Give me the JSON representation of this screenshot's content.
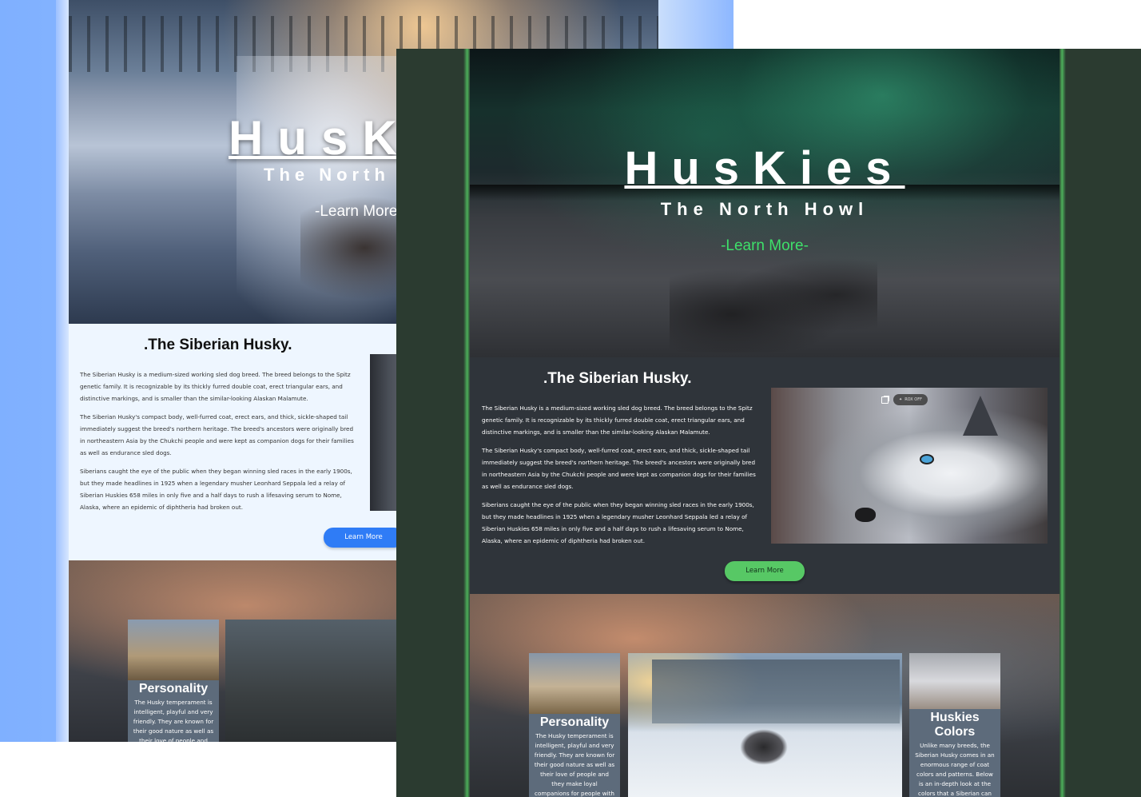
{
  "back_window": {
    "hero": {
      "title": "HusKies",
      "subtitle": "The North Howl",
      "learn_more": "-Learn More-"
    },
    "about": {
      "heading": ".The Siberian Husky.",
      "paragraphs": [
        "The Siberian Husky is a medium-sized working sled dog breed. The breed belongs to the Spitz genetic family. It is recognizable by its thickly furred double coat, erect triangular ears, and distinctive markings, and is smaller than the similar-looking Alaskan Malamute.",
        "The Siberian Husky's compact body, well-furred coat, erect ears, and thick, sickle-shaped tail immediately suggest the breed's northern heritage. The breed's ancestors were originally bred in northeastern Asia by the Chukchi people and were kept as companion dogs for their families as well as endurance sled dogs.",
        "Siberians caught the eye of the public when they began winning sled races in the early 1900s, but they made headlines in 1925 when a legendary musher Leonhard Seppala led a relay of Siberian Huskies 658 miles in only five and a half days to rush a lifesaving serum to Nome, Alaska, where an epidemic of diphtheria had broken out."
      ],
      "button": "Learn More"
    },
    "cards": {
      "personality_title": "Personality",
      "personality_text": "The Husky temperament is intelligent, playful and very friendly. They are known for their good nature as well as their love of people and they"
    }
  },
  "front_window": {
    "hero": {
      "title": "HusKies",
      "subtitle": "The North Howl",
      "learn_more": "-Learn More-"
    },
    "about": {
      "heading": ".The Siberian Husky.",
      "paragraphs": [
        "The Siberian Husky is a medium-sized working sled dog breed. The breed belongs to the Spitz genetic family. It is recognizable by its thickly furred double coat, erect triangular ears, and distinctive markings, and is smaller than the similar-looking Alaskan Malamute.",
        "The Siberian Husky's compact body, well-furred coat, erect ears, and thick, sickle-shaped tail immediately suggest the breed's northern heritage. The breed's ancestors were originally bred in northeastern Asia by the Chukchi people and were kept as companion dogs for their families as well as endurance sled dogs.",
        "Siberians caught the eye of the public when they began winning sled races in the early 1900s, but they made headlines in 1925 when a legendary musher Leonhard Seppala led a relay of Siberian Huskies 658 miles in only five and a half days to rush a lifesaving serum to Nome, Alaska, where an epidemic of diphtheria had broken out."
      ],
      "photo_pill": "ROX OFF",
      "button": "Learn More"
    },
    "cards": {
      "personality_title": "Personality",
      "personality_text": "The Husky temperament is intelligent, playful and very friendly. They are known for their good nature as well as their love of people and they make loyal companions for people with active lifestyles.",
      "colors_title": "Huskies Colors",
      "colors_text": "Unlike many breeds, the Siberian Husky comes in an enormous range of coat colors and patterns. Below is an in-depth look at the colors that a Siberian can wear. Grey, Black/White, Cream/White..."
    }
  },
  "colors": {
    "accent_green": "#3ee06a",
    "button_green": "#57c865",
    "button_blue": "#2f7cf6"
  }
}
